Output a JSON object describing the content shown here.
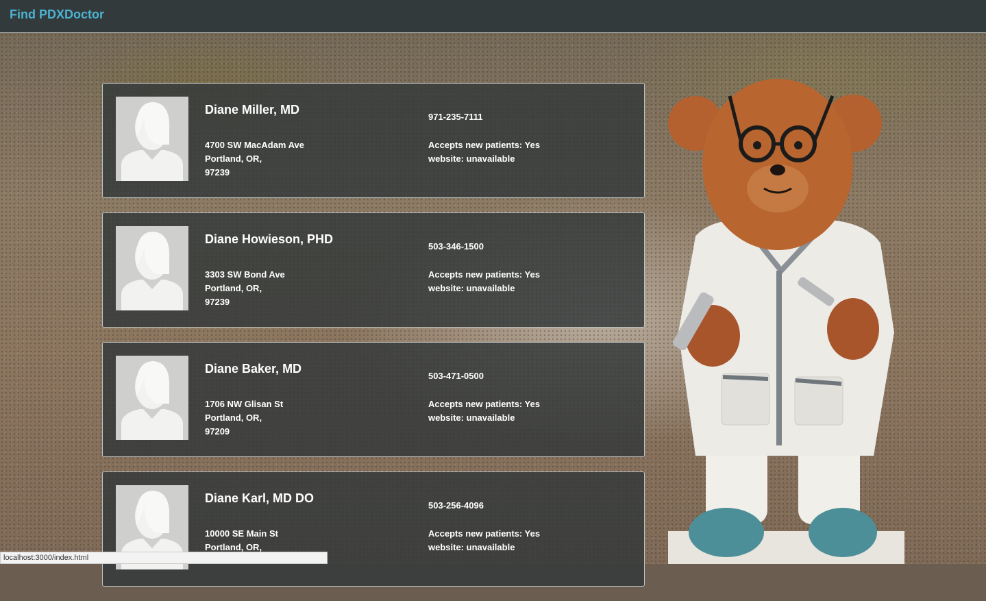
{
  "app": {
    "brand": "Find PDXDoctor"
  },
  "doctors": [
    {
      "name": "Diane Miller, MD",
      "street": "4700 SW MacAdam Ave",
      "city_state": "Portland, OR,",
      "zip": "97239",
      "phone": "971-235-7111",
      "accepts": "Accepts new patients: Yes",
      "website": "website: unavailable"
    },
    {
      "name": "Diane Howieson, PHD",
      "street": "3303 SW Bond Ave",
      "city_state": "Portland, OR,",
      "zip": "97239",
      "phone": "503-346-1500",
      "accepts": "Accepts new patients: Yes",
      "website": "website: unavailable"
    },
    {
      "name": "Diane Baker, MD",
      "street": "1706 NW Glisan St",
      "city_state": "Portland, OR,",
      "zip": "97209",
      "phone": "503-471-0500",
      "accepts": "Accepts new patients: Yes",
      "website": "website: unavailable"
    },
    {
      "name": "Diane Karl, MD DO",
      "street": "10000 SE Main St",
      "city_state": "Portland, OR,",
      "zip": "",
      "phone": "503-256-4096",
      "accepts": "Accepts new patients: Yes",
      "website": "website: unavailable"
    }
  ],
  "status_bar": {
    "url": "localhost:3000/index.html"
  },
  "icons": {
    "avatar": "female-avatar-placeholder-icon"
  }
}
